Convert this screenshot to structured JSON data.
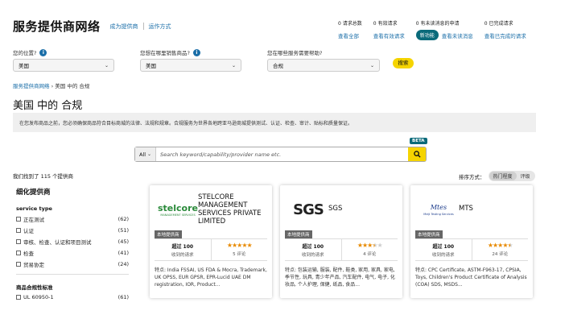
{
  "header": {
    "brand": "服务提供商网络",
    "link_become": "成为提供商",
    "link_how": "运作方式"
  },
  "stats": [
    {
      "title": "0 请求总数",
      "link": "查看全部"
    },
    {
      "title": "0 有效请求",
      "link": "查看有效请求"
    },
    {
      "title": "0 有未读消息的申请",
      "pill": "新功能",
      "link": "查看未读消息"
    },
    {
      "title": "0 已完成请求",
      "link": "查看已完成的请求"
    }
  ],
  "filters": {
    "sell_label": "您的位置?",
    "sell_value": "美国",
    "market_label": "您想在哪里销售商品?",
    "market_value": "美国",
    "service_label": "您在哪些服务需要帮助?",
    "service_value": "合规",
    "search_button": "搜索"
  },
  "breadcrumb": {
    "home": "服务提供商网络",
    "sep": "›",
    "current": "美国 中的 合规"
  },
  "page_title": "美国 中的 合规",
  "banner": "在您发布商品之前，您必须确保商品符合目标商城的法律、法规和规章。合规服务为世界各地跨亚马逊商城提供测试、认证、检查、审计、贴标和质量保证。",
  "search": {
    "scope": "All",
    "placeholder": "Search keyword/capability/provider name etc.",
    "beta": "BETA"
  },
  "results": {
    "found": "我们找到了 115 个提供商",
    "sort_label": "排序方式：",
    "sort_options": [
      "热门程度",
      "评级"
    ]
  },
  "sidebar": {
    "heading": "细化提供商",
    "service_type_label": "service type",
    "service_types": [
      {
        "label": "正在测试",
        "count": "(62)"
      },
      {
        "label": "认证",
        "count": "(51)"
      },
      {
        "label": "审核、检查、认证和项目测试",
        "count": "(45)"
      },
      {
        "label": "检查",
        "count": "(41)"
      },
      {
        "label": "贸易协定",
        "count": "(24)"
      }
    ],
    "standards_label": "商品合规性标准",
    "standards": [
      {
        "label": "UL 60950-1",
        "count": "(61)"
      }
    ]
  },
  "colors": {
    "accent_teal": "#0a6a7a",
    "link_blue": "#1a6ea8",
    "yellow": "#f5d400",
    "star_orange": "#e88a00"
  },
  "cards": [
    {
      "logo_text": "stelcore",
      "logo_sub": "MANAGEMENT SERVICES",
      "name": "STELCORE MANAGEMENT SERVICES PRIVATE LIMITED",
      "tag": "本地提供商",
      "requests_big": "超过 100",
      "requests_small": "收到的请求",
      "rating": 5,
      "reviews": "5 评论",
      "features": "特点: India FSSAI, US FDA & Mocra, Trademark, UK OPSS, EUR GPSR, EPR-Lucid UAE DM registration, IOR, Product..."
    },
    {
      "logo_text": "SGS",
      "name": "SGS",
      "tag": "本地提供商",
      "requests_big": "超过 100",
      "requests_small": "收到的请求",
      "rating": 3.5,
      "reviews": "4 评论",
      "features": "特点: 包装运输, 服装, 配件, 鞋类, 家用, 家具, 家电, 季节性, 玩具, 青少年产品, 汽车配件, 电气, 电子, 化妆品, 个人护理, 保健, 纸品, 食品..."
    },
    {
      "logo_text": "Mtes",
      "logo_sub": "Meiji Testing Services",
      "name": "MTS",
      "tag": "本地提供商",
      "requests_big": "超过 100",
      "requests_small": "收到的请求",
      "rating": 4.5,
      "reviews": "24 评论",
      "features": "特点: CPC Certificate, ASTM-F963-17, CPSIA, Toys, Children's Product Certificate of Analysis (COA) SDS, MSDS..."
    }
  ]
}
